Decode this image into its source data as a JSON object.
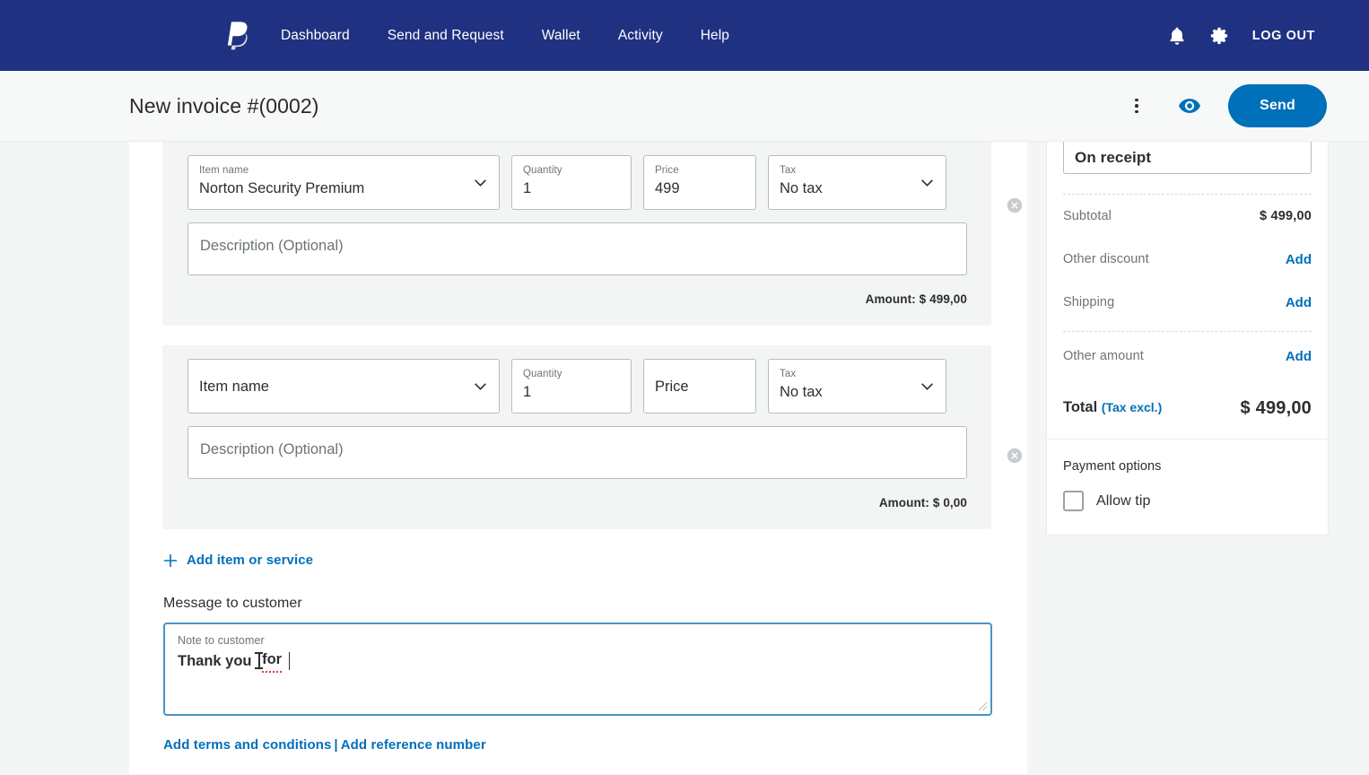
{
  "nav": {
    "logo_icon": "paypal-logo-icon",
    "links": [
      {
        "label": "Dashboard"
      },
      {
        "label": "Send and Request"
      },
      {
        "label": "Wallet"
      },
      {
        "label": "Activity"
      },
      {
        "label": "Help"
      }
    ],
    "bell_icon": "bell-icon",
    "gear_icon": "gear-icon",
    "logout_label": "LOG OUT"
  },
  "subheader": {
    "title": "New invoice #(0002)",
    "more_icon": "kebab-menu-icon",
    "preview_icon": "eye-icon",
    "send_label": "Send"
  },
  "items": [
    {
      "name_label": "Item name",
      "name_value": "Norton Security Premium",
      "qty_label": "Quantity",
      "qty_value": "1",
      "price_label": "Price",
      "price_value": "499",
      "tax_label": "Tax",
      "tax_value": "No tax",
      "description_placeholder": "Description (Optional)",
      "description_value": "",
      "amount_label": "Amount:",
      "amount_value": "$ 499,00"
    },
    {
      "name_label": "Item name",
      "name_value": "",
      "name_placeholder": "Item name",
      "qty_label": "Quantity",
      "qty_value": "1",
      "price_label": "Price",
      "price_value": "",
      "price_placeholder": "Price",
      "tax_label": "Tax",
      "tax_value": "No tax",
      "description_placeholder": "Description (Optional)",
      "description_value": "",
      "amount_label": "Amount:",
      "amount_value": "$ 0,00"
    }
  ],
  "add_item": {
    "icon": "plus-icon",
    "label": "Add item or service"
  },
  "message": {
    "section_label": "Message to customer",
    "float_label": "Note to customer",
    "text_before_cursor": "Thank you ",
    "spellchecked_word": "for",
    "text_after": " "
  },
  "footer_links": {
    "terms": "Add terms and conditions",
    "separator": "|",
    "reference": "Add reference number"
  },
  "sidebar": {
    "due_value": "On receipt",
    "rows": [
      {
        "label": "Subtotal",
        "value": "$ 499,00",
        "is_link": false
      },
      {
        "label": "Other discount",
        "value": "Add",
        "is_link": true
      },
      {
        "label": "Shipping",
        "value": "Add",
        "is_link": true
      },
      {
        "label": "Other amount",
        "value": "Add",
        "is_link": true
      }
    ],
    "total_label": "Total",
    "total_tax_note": "(Tax excl.)",
    "total_value": "$ 499,00",
    "payment_options_label": "Payment options",
    "allow_tip_label": "Allow tip",
    "allow_tip_checked": false
  },
  "colors": {
    "nav_blue": "#1f3180",
    "accent_blue": "#0070ba",
    "link_blue": "#0070ba",
    "card_gray": "#f3f4f4",
    "page_gray": "#f4f5f5"
  }
}
